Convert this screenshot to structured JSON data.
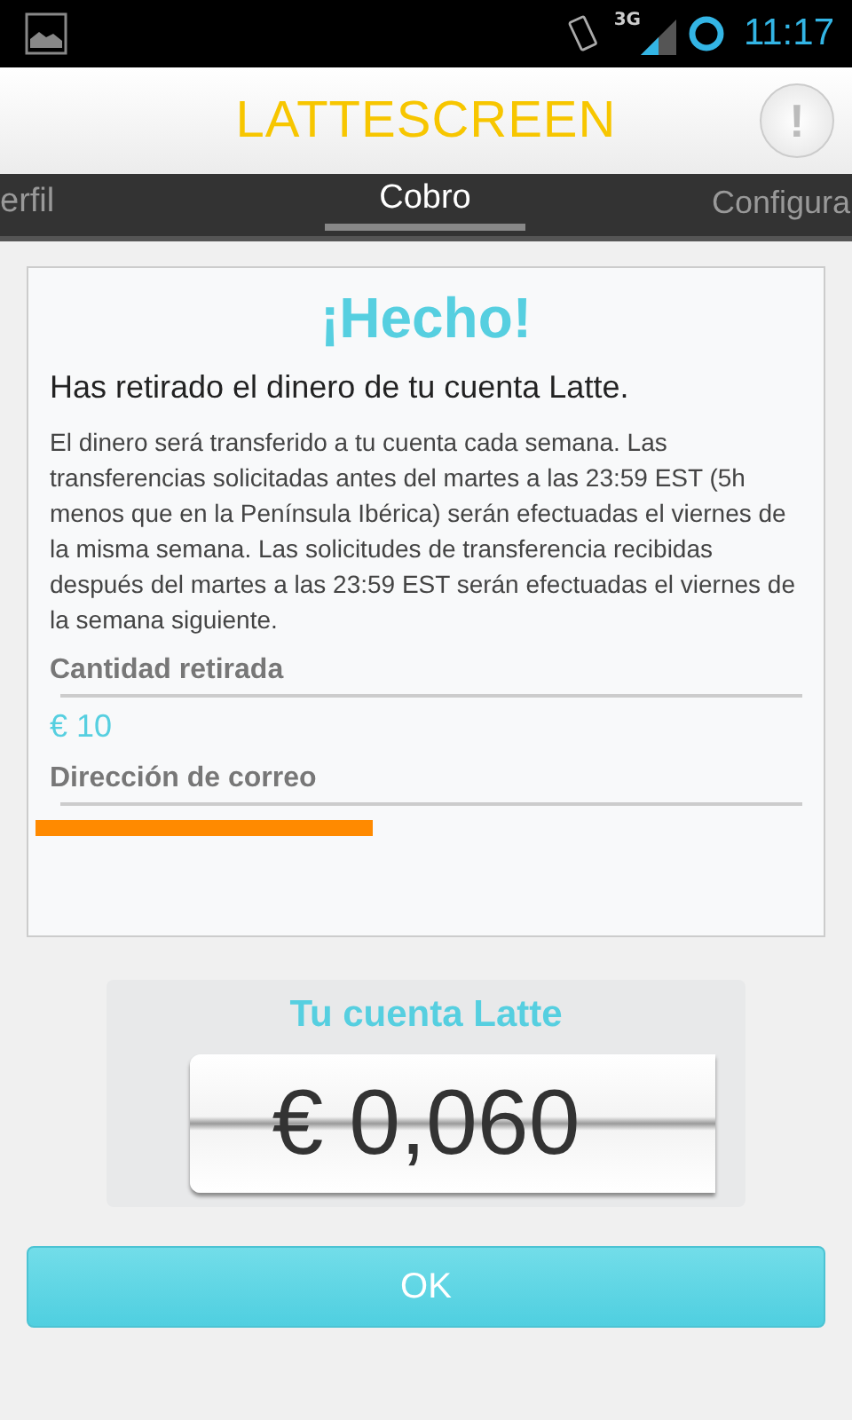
{
  "status_bar": {
    "network": "3G",
    "time": "11:17"
  },
  "header": {
    "title": "LATTESCREEN",
    "alert_button": "!"
  },
  "tabs": [
    {
      "label": "erfil",
      "selected": false
    },
    {
      "label": "Cobro",
      "selected": true
    },
    {
      "label": "Configura",
      "selected": false
    }
  ],
  "card": {
    "title": "¡Hecho!",
    "subtitle": "Has retirado el dinero de tu cuenta Latte.",
    "body": "El dinero será transferido a tu cuenta cada semana. Las transferencias solicitadas antes del martes a las 23:59 EST (5h menos que en la Península Ibérica) serán efectuadas el viernes de la misma semana. Las solicitudes de transferencia recibidas después del martes a las 23:59 EST serán efectuadas el viernes de la semana siguiente.",
    "fields": [
      {
        "label": "Cantidad retirada",
        "value": "€ 10",
        "redacted": false
      },
      {
        "label": "Dirección de correo",
        "redacted": true
      }
    ]
  },
  "account": {
    "title": "Tu cuenta Latte",
    "balance": "€ 0,060"
  },
  "buttons": [
    "OK"
  ]
}
